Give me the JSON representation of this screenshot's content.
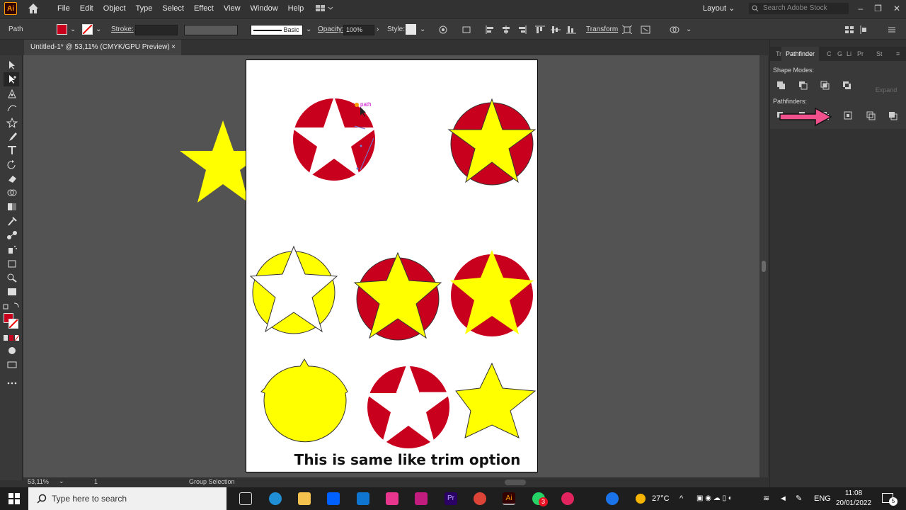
{
  "app": {
    "logo": "Ai"
  },
  "menu": [
    "File",
    "Edit",
    "Object",
    "Type",
    "Select",
    "Effect",
    "View",
    "Window",
    "Help"
  ],
  "workspace": {
    "label": "Layout",
    "search_placeholder": "Search Adobe Stock"
  },
  "control": {
    "selection_type": "Path",
    "stroke_label": "Stroke:",
    "brush_label": "Basic",
    "opacity_label": "Opacity:",
    "opacity_value": "100%",
    "style_label": "Style:",
    "transform_label": "Transform"
  },
  "document": {
    "tab_title": "Untitled-1* @ 53,11% (CMYK/GPU Preview)",
    "close": "×"
  },
  "canvas": {
    "hover_label": "path",
    "caption": "This is same like trim option"
  },
  "status": {
    "zoom": "53,11%",
    "artboard": "1",
    "tool": "Group Selection"
  },
  "panel": {
    "tabs": [
      "Tr",
      "Pathfinder",
      "C",
      "G",
      "Li",
      "Pr",
      "St"
    ],
    "shape_modes_label": "Shape Modes:",
    "expand_label": "Expand",
    "pathfinders_label": "Pathfinders:"
  },
  "taskbar": {
    "search_placeholder": "Type here to search",
    "weather": "27°C",
    "language": "ENG",
    "time": "11:08",
    "date": "20/01/2022",
    "notifications": "5",
    "badge": "3"
  },
  "colors": {
    "fill": "#c8001e",
    "star": "#ffff00",
    "arrow": "#f0508c"
  }
}
